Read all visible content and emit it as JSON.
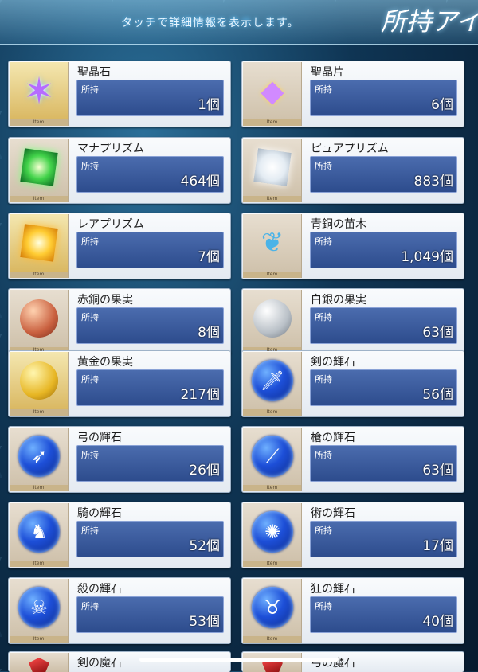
{
  "header": {
    "hint": "タッチで詳細情報を表示します。",
    "title": "所持アイ"
  },
  "owned_label": "所持",
  "item_tag": "Item",
  "items": [
    {
      "name": "聖晶石",
      "count": "1個",
      "icon": "saint-quartz-icon"
    },
    {
      "name": "聖晶片",
      "count": "6個",
      "icon": "quartz-fragment-icon"
    },
    {
      "name": "マナプリズム",
      "count": "464個",
      "icon": "mana-prism-icon"
    },
    {
      "name": "ピュアプリズム",
      "count": "883個",
      "icon": "pure-prism-icon"
    },
    {
      "name": "レアプリズム",
      "count": "7個",
      "icon": "rare-prism-icon"
    },
    {
      "name": "青銅の苗木",
      "count": "1,049個",
      "icon": "bronze-sapling-icon"
    },
    {
      "name": "赤銅の果実",
      "count": "8個",
      "icon": "bronze-fruit-icon"
    },
    {
      "name": "白銀の果実",
      "count": "63個",
      "icon": "silver-fruit-icon"
    },
    {
      "name": "黄金の果実",
      "count": "217個",
      "icon": "golden-fruit-icon"
    },
    {
      "name": "剣の輝石",
      "count": "56個",
      "icon": "saber-gem-icon"
    },
    {
      "name": "弓の輝石",
      "count": "26個",
      "icon": "archer-gem-icon"
    },
    {
      "name": "槍の輝石",
      "count": "63個",
      "icon": "lancer-gem-icon"
    },
    {
      "name": "騎の輝石",
      "count": "52個",
      "icon": "rider-gem-icon"
    },
    {
      "name": "術の輝石",
      "count": "17個",
      "icon": "caster-gem-icon"
    },
    {
      "name": "殺の輝石",
      "count": "53個",
      "icon": "assassin-gem-icon"
    },
    {
      "name": "狂の輝石",
      "count": "40個",
      "icon": "berserker-gem-icon"
    }
  ],
  "peek": {
    "left_name": "剣の魔石",
    "right_name": "弓の魔石"
  }
}
